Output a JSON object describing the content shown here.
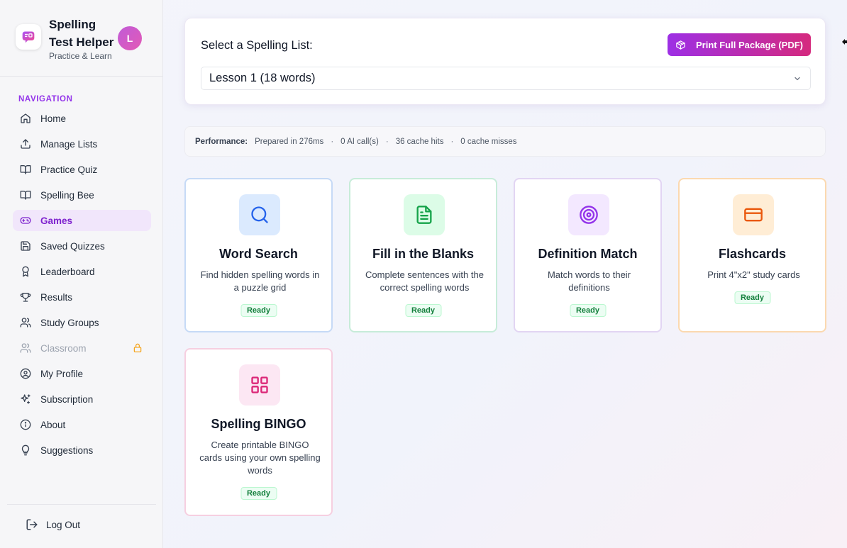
{
  "app": {
    "title": "Spelling Test Helper",
    "subtitle": "Practice & Learn",
    "avatar_initial": "L"
  },
  "sidebar": {
    "heading": "NAVIGATION",
    "items": [
      {
        "label": "Home",
        "icon": "home-icon"
      },
      {
        "label": "Manage Lists",
        "icon": "upload-icon"
      },
      {
        "label": "Practice Quiz",
        "icon": "book-open-icon"
      },
      {
        "label": "Spelling Bee",
        "icon": "book-open-icon"
      },
      {
        "label": "Games",
        "icon": "gamepad-icon",
        "active": true
      },
      {
        "label": "Saved Quizzes",
        "icon": "save-icon"
      },
      {
        "label": "Leaderboard",
        "icon": "award-icon"
      },
      {
        "label": "Results",
        "icon": "trophy-icon"
      },
      {
        "label": "Study Groups",
        "icon": "users-icon"
      },
      {
        "label": "Classroom",
        "icon": "users-icon",
        "disabled": true,
        "locked": true
      },
      {
        "label": "My Profile",
        "icon": "user-circle-icon"
      },
      {
        "label": "Subscription",
        "icon": "sparkles-icon"
      },
      {
        "label": "About",
        "icon": "info-icon"
      },
      {
        "label": "Suggestions",
        "icon": "lightbulb-icon"
      }
    ],
    "logout_label": "Log Out"
  },
  "list_selector": {
    "label": "Select a Spelling List:",
    "selected": "Lesson 1 (18 words)",
    "print_button": "Print Full Package (PDF)"
  },
  "performance": {
    "label": "Performance:",
    "prepared": "Prepared in 276ms",
    "ai_calls": "0 AI call(s)",
    "cache_hits": "36 cache hits",
    "cache_misses": "0 cache misses"
  },
  "games": [
    {
      "title": "Word Search",
      "description": "Find hidden spelling words in a puzzle grid",
      "status": "Ready",
      "icon": "search-icon",
      "color": "#2563eb",
      "bg": "#dbeafe"
    },
    {
      "title": "Fill in the Blanks",
      "description": "Complete sentences with the correct spelling words",
      "status": "Ready",
      "icon": "document-icon",
      "color": "#16a34a",
      "bg": "#dcfce7"
    },
    {
      "title": "Definition Match",
      "description": "Match words to their definitions",
      "status": "Ready",
      "icon": "target-icon",
      "color": "#9333ea",
      "bg": "#f3e8ff"
    },
    {
      "title": "Flashcards",
      "description": "Print 4\"x2\" study cards",
      "status": "Ready",
      "icon": "card-icon",
      "color": "#ea580c",
      "bg": "#ffedd5"
    },
    {
      "title": "Spelling BINGO",
      "description": "Create printable BINGO cards using your own spelling words",
      "status": "Ready",
      "icon": "grid-icon",
      "color": "#db2777",
      "bg": "#fce7f3"
    }
  ]
}
